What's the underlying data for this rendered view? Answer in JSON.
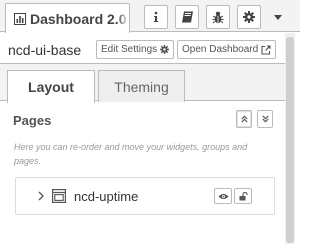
{
  "sidebar_tab": {
    "label": "Dashboard 2.0"
  },
  "toolbar": {
    "icons": [
      "info-icon",
      "book-icon",
      "bug-icon",
      "gear-icon",
      "caret-down-icon"
    ]
  },
  "header": {
    "site_name": "ncd-ui-base",
    "edit_settings_label": "Edit Settings",
    "open_dashboard_label": "Open Dashboard"
  },
  "tabs": [
    {
      "label": "Layout",
      "active": true
    },
    {
      "label": "Theming",
      "active": false
    }
  ],
  "pages_section": {
    "title": "Pages",
    "help_text": "Here you can re-order and move your widgets, groups and pages."
  },
  "page_items": [
    {
      "label": "ncd-uptime"
    }
  ],
  "colors": {
    "border": "#bbbbbb",
    "tab_bar_bg": "#f3f3f3",
    "text": "#555555",
    "help_text": "#999999"
  }
}
